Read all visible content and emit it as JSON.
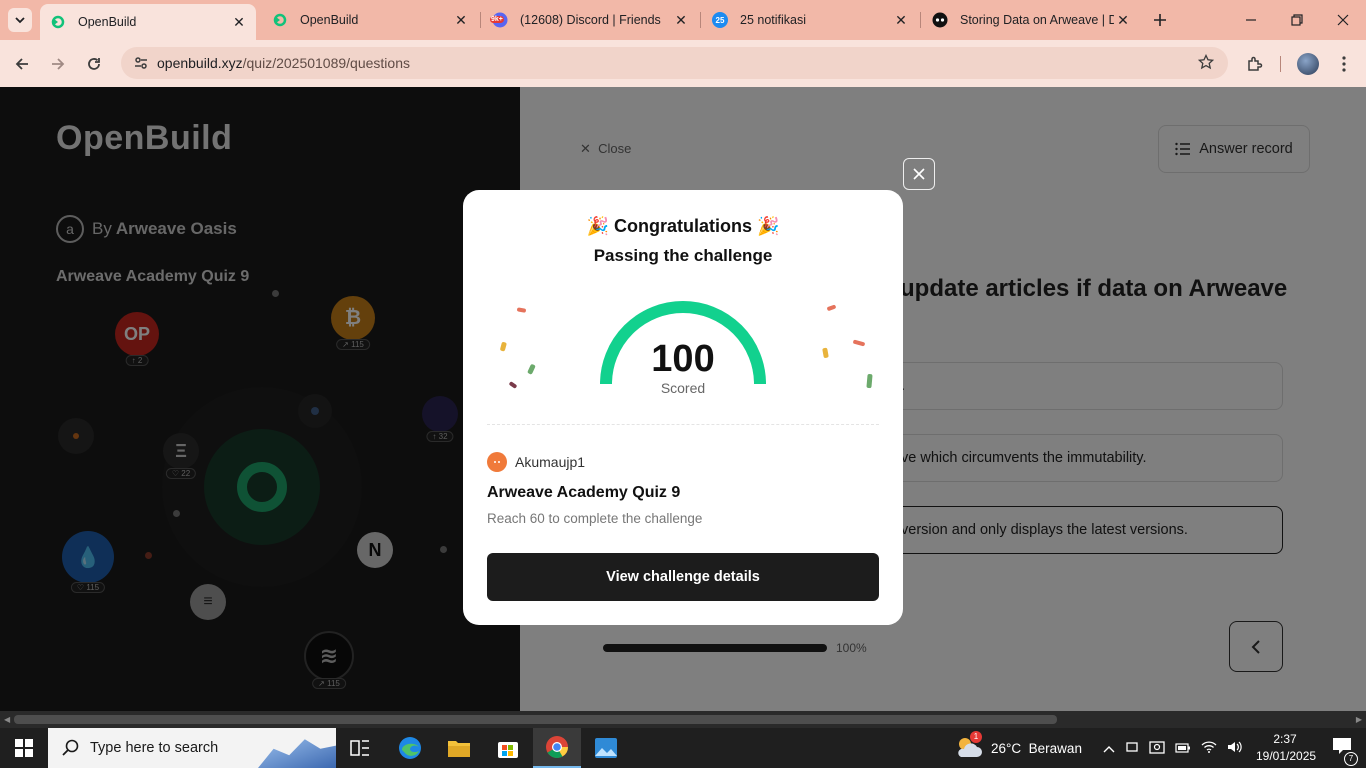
{
  "browser": {
    "tabs": [
      {
        "title": "OpenBuild",
        "icon": "openbuild-icon",
        "active": true
      },
      {
        "title": "OpenBuild",
        "icon": "openbuild-icon",
        "active": false
      },
      {
        "title": "(12608) Discord | Friends",
        "icon": "discord-icon",
        "badge": "9k+",
        "active": false
      },
      {
        "title": "25 notifikasi",
        "icon": "notification-icon",
        "badge": "25",
        "active": false
      },
      {
        "title": "Storing Data on Arweave | D",
        "icon": "site-icon",
        "active": false
      }
    ],
    "url_host": "openbuild.xyz",
    "url_path": "/quiz/202501089/questions"
  },
  "sidebar": {
    "logo": "OpenBuild",
    "by_prefix": "By",
    "by_name": "Arweave Oasis",
    "quiz_name": "Arweave Academy Quiz 9",
    "chips": [
      {
        "label": "OP",
        "count": "2"
      },
      {
        "label": "₿",
        "count": "115"
      },
      {
        "label": "Ξ",
        "count": "22"
      },
      {
        "label": "N",
        "count": ""
      },
      {
        "label": "32",
        "count": "32"
      },
      {
        "label": "115",
        "count": "115"
      },
      {
        "label": "115",
        "count": "115"
      }
    ]
  },
  "question": {
    "close_label": "Close",
    "answer_record": "Answer record",
    "title_fragment": "update articles if data on Arweave",
    "options": [
      ".",
      "ve which circumvents the immutability.",
      "version and only displays the latest versions."
    ],
    "progress": 1.0,
    "progress_text": "100%"
  },
  "modal": {
    "title": "Congratulations",
    "subtitle": "Passing the challenge",
    "score": "100",
    "score_label": "Scored",
    "score_fraction": 1.0,
    "username": "Akumaujp1",
    "quiz": "Arweave Academy Quiz 9",
    "requirement": "Reach 60 to complete the challenge",
    "button": "View challenge details",
    "accent": "#12d18e"
  },
  "taskbar": {
    "search_placeholder": "Type here to search",
    "weather": "26°C  Berawan",
    "time": "2:37",
    "date": "19/01/2025",
    "notif_count": "7",
    "weather_badge": "1"
  }
}
